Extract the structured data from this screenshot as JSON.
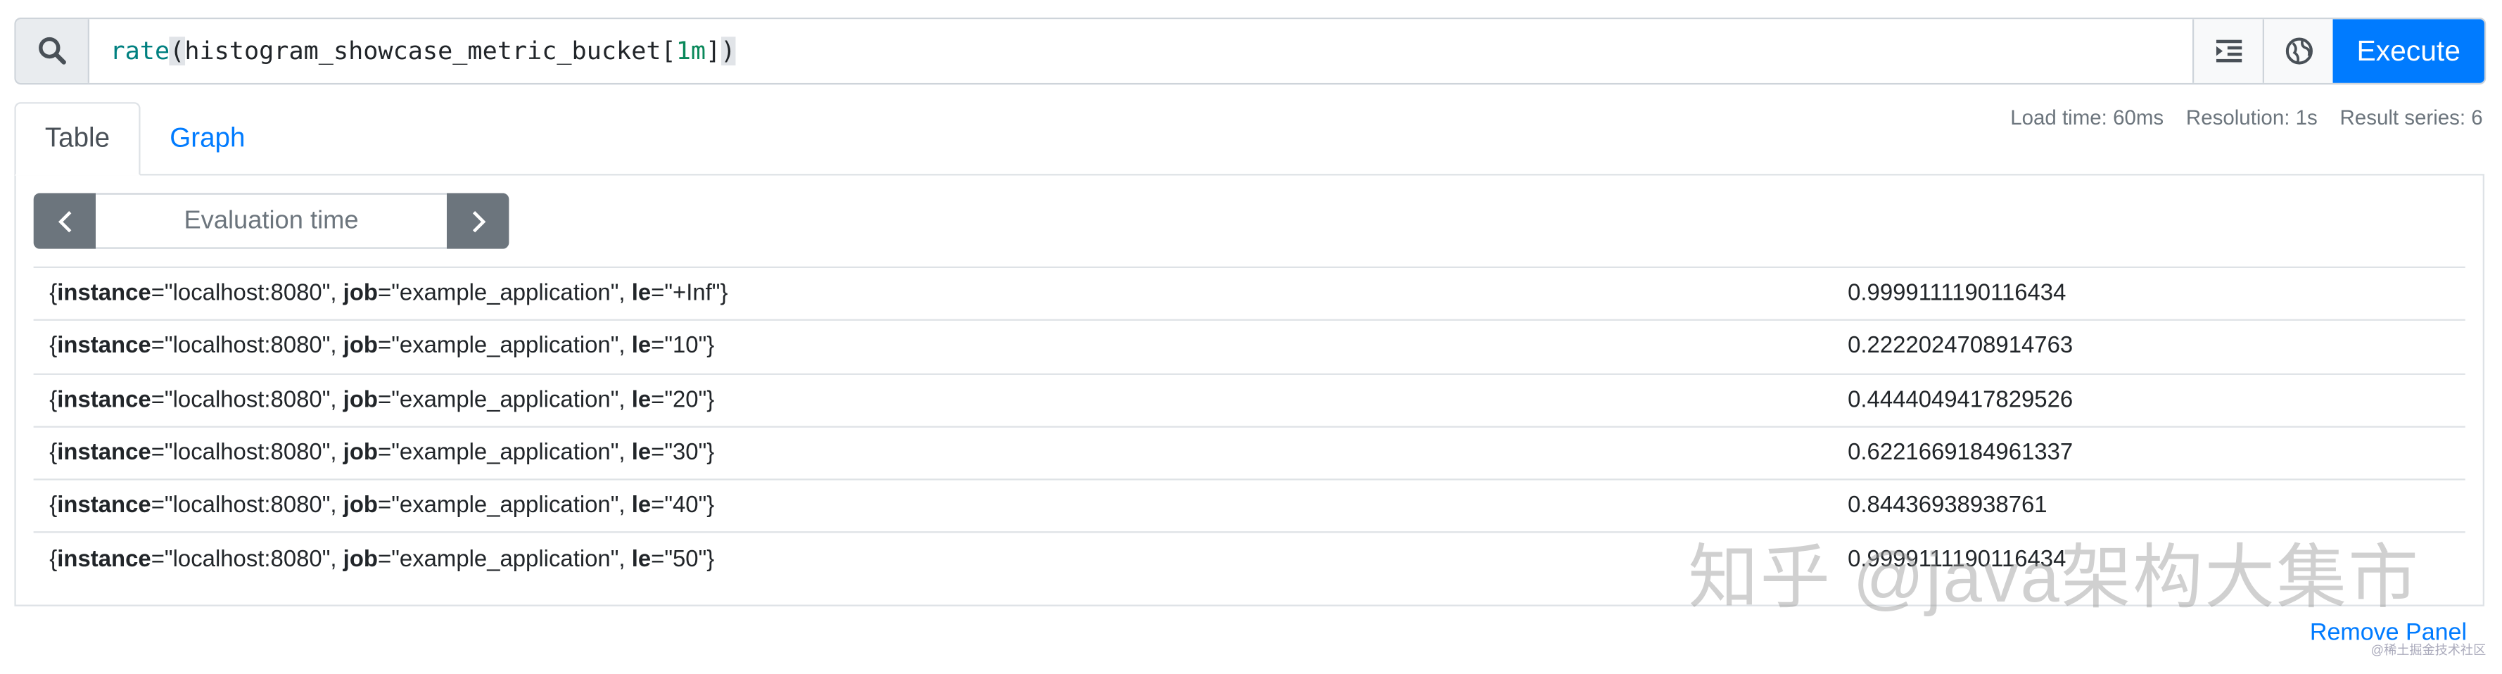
{
  "query": {
    "fn": "rate",
    "open": "(",
    "metric": "histogram_showcase_metric_bucket[",
    "range": "1m",
    "close_bracket": "]",
    "close": ")",
    "execute_label": "Execute"
  },
  "tabs": {
    "table": "Table",
    "graph": "Graph"
  },
  "stats": {
    "load_time": "Load time: 60ms",
    "resolution": "Resolution: 1s",
    "result_series": "Result series: 6"
  },
  "eval": {
    "placeholder": "Evaluation time"
  },
  "rows": [
    {
      "instance": "localhost:8080",
      "job": "example_application",
      "le": "+Inf",
      "value": "0.9999111190116434"
    },
    {
      "instance": "localhost:8080",
      "job": "example_application",
      "le": "10",
      "value": "0.2222024708914763"
    },
    {
      "instance": "localhost:8080",
      "job": "example_application",
      "le": "20",
      "value": "0.4444049417829526"
    },
    {
      "instance": "localhost:8080",
      "job": "example_application",
      "le": "30",
      "value": "0.6221669184961337"
    },
    {
      "instance": "localhost:8080",
      "job": "example_application",
      "le": "40",
      "value": "0.84436938938761"
    },
    {
      "instance": "localhost:8080",
      "job": "example_application",
      "le": "50",
      "value": "0.9999111190116434"
    }
  ],
  "labels": {
    "instance": "instance",
    "job": "job",
    "le": "le"
  },
  "remove_panel": "Remove Panel",
  "watermark": "知乎 @java架构大集市",
  "watermark_small": "@稀土掘金技术社区",
  "colors": {
    "accent": "#007bff",
    "nav_button": "#6c757d"
  },
  "icons": [
    "search-icon",
    "indent-icon",
    "globe-icon",
    "chevron-left-icon",
    "chevron-right-icon"
  ]
}
